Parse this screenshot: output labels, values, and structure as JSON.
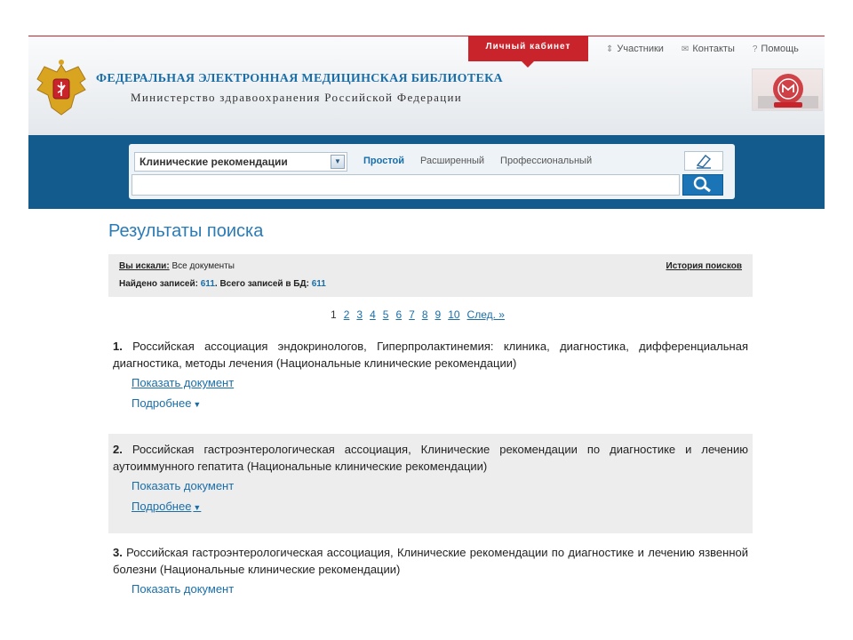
{
  "header": {
    "cabinet_label": "Личный кабинет",
    "links": [
      {
        "label": "Участники",
        "icon": "participants-icon",
        "glyph": "⇕"
      },
      {
        "label": "Контакты",
        "icon": "mail-icon",
        "glyph": "✉"
      },
      {
        "label": "Помощь",
        "icon": "help-icon",
        "glyph": "?"
      }
    ],
    "title": "ФЕДЕРАЛЬНАЯ ЭЛЕКТРОННАЯ МЕДИЦИНСКАЯ БИБЛИОТЕКА",
    "subtitle": "Министерство здравоохранения Российской Федерации",
    "colors": {
      "accent_red": "#c9242b",
      "brand_blue": "#135a8d",
      "link_blue": "#1a6ea8"
    }
  },
  "search": {
    "category_value": "Клинические рекомендации",
    "modes": [
      "Простой",
      "Расширенный",
      "Профессиональный"
    ],
    "active_mode": "Простой",
    "query_value": ""
  },
  "results": {
    "title": "Результаты поиска",
    "searched_label": "Вы искали:",
    "searched_value": "Все документы",
    "history_label": "История поисков",
    "found_label": "Найдено записей:",
    "found_count": "611",
    "total_label": ". Всего записей в БД:",
    "total_count": "611",
    "pager": [
      "1",
      "2",
      "3",
      "4",
      "5",
      "6",
      "7",
      "8",
      "9",
      "10",
      "След. »"
    ],
    "current_page": "1",
    "items": [
      {
        "number": "1.",
        "text": "Российская ассоциация эндокринологов, Гиперпролактинемия: клиника, диагностика, дифференциальная диагностика, методы лечения (Национальные клинические рекомендации)",
        "show_label": "Показать документ",
        "more_label": "Подробнее"
      },
      {
        "number": "2.",
        "text": "Российская гастроэнтерологическая ассоциация, Клинические рекомендации по диагностике и лечению аутоиммунного гепатита (Национальные клинические рекомендации)",
        "show_label": "Показать документ",
        "more_label": "Подробнее"
      },
      {
        "number": "3.",
        "text": "Российская гастроэнтерологическая ассоциация, Клинические рекомендации по диагностике и лечению язвенной болезни (Национальные клинические рекомендации)",
        "show_label": "Показать документ"
      }
    ]
  }
}
